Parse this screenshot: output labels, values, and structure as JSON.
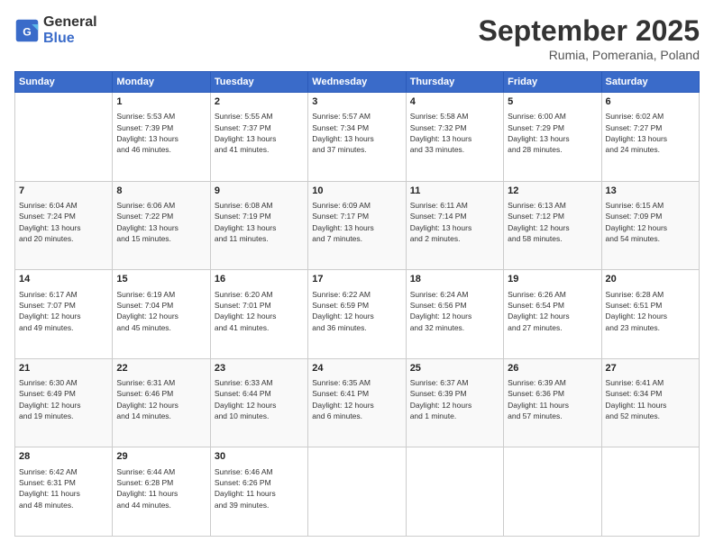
{
  "header": {
    "logo_line1": "General",
    "logo_line2": "Blue",
    "month": "September 2025",
    "location": "Rumia, Pomerania, Poland"
  },
  "weekdays": [
    "Sunday",
    "Monday",
    "Tuesday",
    "Wednesday",
    "Thursday",
    "Friday",
    "Saturday"
  ],
  "weeks": [
    [
      {
        "day": "",
        "info": ""
      },
      {
        "day": "1",
        "info": "Sunrise: 5:53 AM\nSunset: 7:39 PM\nDaylight: 13 hours\nand 46 minutes."
      },
      {
        "day": "2",
        "info": "Sunrise: 5:55 AM\nSunset: 7:37 PM\nDaylight: 13 hours\nand 41 minutes."
      },
      {
        "day": "3",
        "info": "Sunrise: 5:57 AM\nSunset: 7:34 PM\nDaylight: 13 hours\nand 37 minutes."
      },
      {
        "day": "4",
        "info": "Sunrise: 5:58 AM\nSunset: 7:32 PM\nDaylight: 13 hours\nand 33 minutes."
      },
      {
        "day": "5",
        "info": "Sunrise: 6:00 AM\nSunset: 7:29 PM\nDaylight: 13 hours\nand 28 minutes."
      },
      {
        "day": "6",
        "info": "Sunrise: 6:02 AM\nSunset: 7:27 PM\nDaylight: 13 hours\nand 24 minutes."
      }
    ],
    [
      {
        "day": "7",
        "info": "Sunrise: 6:04 AM\nSunset: 7:24 PM\nDaylight: 13 hours\nand 20 minutes."
      },
      {
        "day": "8",
        "info": "Sunrise: 6:06 AM\nSunset: 7:22 PM\nDaylight: 13 hours\nand 15 minutes."
      },
      {
        "day": "9",
        "info": "Sunrise: 6:08 AM\nSunset: 7:19 PM\nDaylight: 13 hours\nand 11 minutes."
      },
      {
        "day": "10",
        "info": "Sunrise: 6:09 AM\nSunset: 7:17 PM\nDaylight: 13 hours\nand 7 minutes."
      },
      {
        "day": "11",
        "info": "Sunrise: 6:11 AM\nSunset: 7:14 PM\nDaylight: 13 hours\nand 2 minutes."
      },
      {
        "day": "12",
        "info": "Sunrise: 6:13 AM\nSunset: 7:12 PM\nDaylight: 12 hours\nand 58 minutes."
      },
      {
        "day": "13",
        "info": "Sunrise: 6:15 AM\nSunset: 7:09 PM\nDaylight: 12 hours\nand 54 minutes."
      }
    ],
    [
      {
        "day": "14",
        "info": "Sunrise: 6:17 AM\nSunset: 7:07 PM\nDaylight: 12 hours\nand 49 minutes."
      },
      {
        "day": "15",
        "info": "Sunrise: 6:19 AM\nSunset: 7:04 PM\nDaylight: 12 hours\nand 45 minutes."
      },
      {
        "day": "16",
        "info": "Sunrise: 6:20 AM\nSunset: 7:01 PM\nDaylight: 12 hours\nand 41 minutes."
      },
      {
        "day": "17",
        "info": "Sunrise: 6:22 AM\nSunset: 6:59 PM\nDaylight: 12 hours\nand 36 minutes."
      },
      {
        "day": "18",
        "info": "Sunrise: 6:24 AM\nSunset: 6:56 PM\nDaylight: 12 hours\nand 32 minutes."
      },
      {
        "day": "19",
        "info": "Sunrise: 6:26 AM\nSunset: 6:54 PM\nDaylight: 12 hours\nand 27 minutes."
      },
      {
        "day": "20",
        "info": "Sunrise: 6:28 AM\nSunset: 6:51 PM\nDaylight: 12 hours\nand 23 minutes."
      }
    ],
    [
      {
        "day": "21",
        "info": "Sunrise: 6:30 AM\nSunset: 6:49 PM\nDaylight: 12 hours\nand 19 minutes."
      },
      {
        "day": "22",
        "info": "Sunrise: 6:31 AM\nSunset: 6:46 PM\nDaylight: 12 hours\nand 14 minutes."
      },
      {
        "day": "23",
        "info": "Sunrise: 6:33 AM\nSunset: 6:44 PM\nDaylight: 12 hours\nand 10 minutes."
      },
      {
        "day": "24",
        "info": "Sunrise: 6:35 AM\nSunset: 6:41 PM\nDaylight: 12 hours\nand 6 minutes."
      },
      {
        "day": "25",
        "info": "Sunrise: 6:37 AM\nSunset: 6:39 PM\nDaylight: 12 hours\nand 1 minute."
      },
      {
        "day": "26",
        "info": "Sunrise: 6:39 AM\nSunset: 6:36 PM\nDaylight: 11 hours\nand 57 minutes."
      },
      {
        "day": "27",
        "info": "Sunrise: 6:41 AM\nSunset: 6:34 PM\nDaylight: 11 hours\nand 52 minutes."
      }
    ],
    [
      {
        "day": "28",
        "info": "Sunrise: 6:42 AM\nSunset: 6:31 PM\nDaylight: 11 hours\nand 48 minutes."
      },
      {
        "day": "29",
        "info": "Sunrise: 6:44 AM\nSunset: 6:28 PM\nDaylight: 11 hours\nand 44 minutes."
      },
      {
        "day": "30",
        "info": "Sunrise: 6:46 AM\nSunset: 6:26 PM\nDaylight: 11 hours\nand 39 minutes."
      },
      {
        "day": "",
        "info": ""
      },
      {
        "day": "",
        "info": ""
      },
      {
        "day": "",
        "info": ""
      },
      {
        "day": "",
        "info": ""
      }
    ]
  ]
}
